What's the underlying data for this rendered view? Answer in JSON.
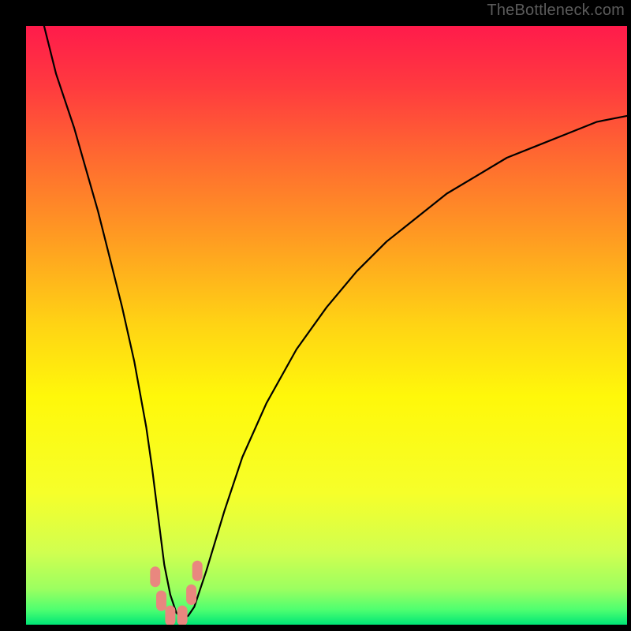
{
  "watermark": "TheBottleneck.com",
  "gradient": {
    "stops": [
      {
        "offset": 0.0,
        "color": "#ff1b4b"
      },
      {
        "offset": 0.1,
        "color": "#ff3a3f"
      },
      {
        "offset": 0.22,
        "color": "#ff6a30"
      },
      {
        "offset": 0.35,
        "color": "#ff9a22"
      },
      {
        "offset": 0.5,
        "color": "#ffd414"
      },
      {
        "offset": 0.62,
        "color": "#fff80a"
      },
      {
        "offset": 0.78,
        "color": "#f6ff2a"
      },
      {
        "offset": 0.88,
        "color": "#d0ff50"
      },
      {
        "offset": 0.94,
        "color": "#9cff60"
      },
      {
        "offset": 0.975,
        "color": "#4eff70"
      },
      {
        "offset": 1.0,
        "color": "#00e676"
      }
    ]
  },
  "chart_data": {
    "type": "line",
    "title": "",
    "xlabel": "",
    "ylabel": "",
    "xlim": [
      0,
      100
    ],
    "ylim": [
      0,
      100
    ],
    "series": [
      {
        "name": "curve",
        "x": [
          3,
          5,
          8,
          10,
          12,
          14,
          16,
          18,
          20,
          21,
          22,
          23,
          24,
          25,
          26,
          27,
          28,
          30,
          33,
          36,
          40,
          45,
          50,
          55,
          60,
          65,
          70,
          75,
          80,
          85,
          90,
          95,
          100
        ],
        "values": [
          100,
          92,
          83,
          76,
          69,
          61,
          53,
          44,
          33,
          26,
          18,
          10,
          5,
          2,
          1,
          1.5,
          3,
          9,
          19,
          28,
          37,
          46,
          53,
          59,
          64,
          68,
          72,
          75,
          78,
          80,
          82,
          84,
          85
        ]
      }
    ],
    "markers": [
      {
        "x": 21.5,
        "y": 8
      },
      {
        "x": 22.5,
        "y": 4
      },
      {
        "x": 24.0,
        "y": 1.5
      },
      {
        "x": 26.0,
        "y": 1.5
      },
      {
        "x": 27.5,
        "y": 5
      },
      {
        "x": 28.5,
        "y": 9
      }
    ],
    "marker_color": "#e9877f"
  }
}
